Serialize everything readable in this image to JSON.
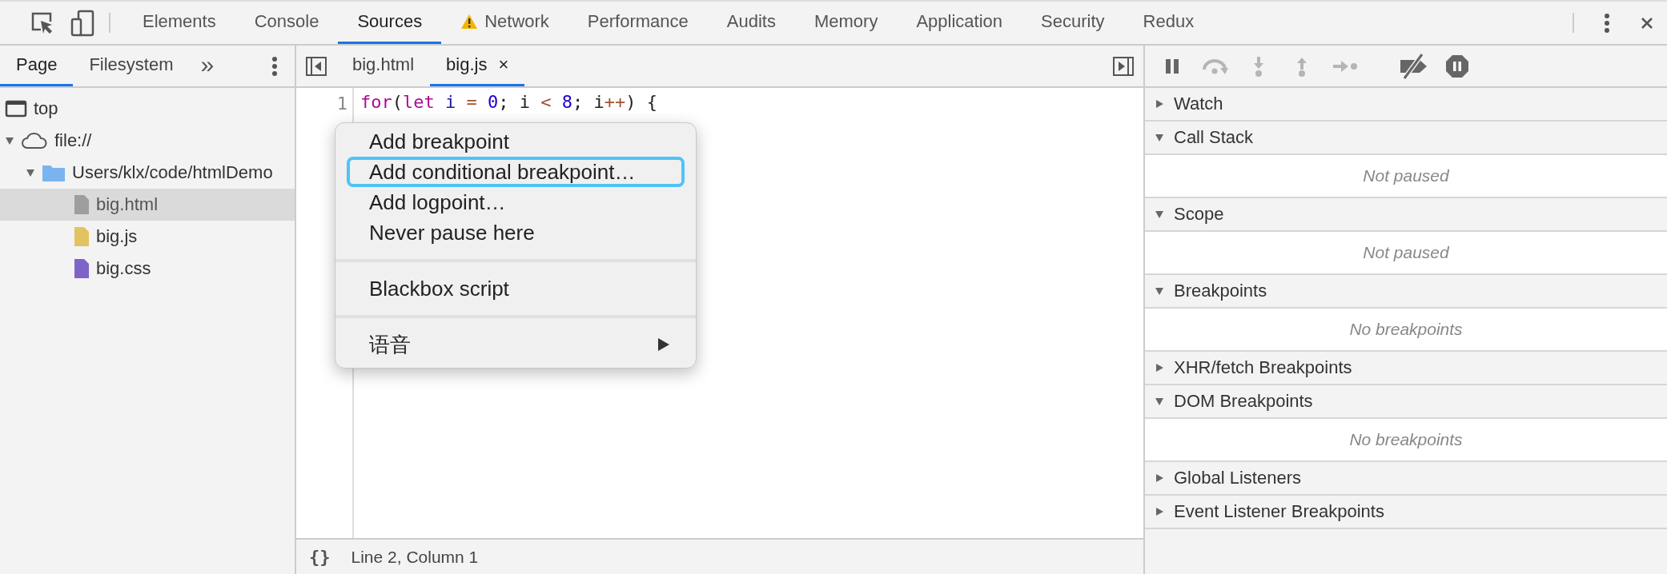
{
  "main_tabs": [
    {
      "label": "Elements",
      "selected": false,
      "warning": false
    },
    {
      "label": "Console",
      "selected": false,
      "warning": false
    },
    {
      "label": "Sources",
      "selected": true,
      "warning": false
    },
    {
      "label": "Network",
      "selected": false,
      "warning": true
    },
    {
      "label": "Performance",
      "selected": false,
      "warning": false
    },
    {
      "label": "Audits",
      "selected": false,
      "warning": false
    },
    {
      "label": "Memory",
      "selected": false,
      "warning": false
    },
    {
      "label": "Application",
      "selected": false,
      "warning": false
    },
    {
      "label": "Security",
      "selected": false,
      "warning": false
    },
    {
      "label": "Redux",
      "selected": false,
      "warning": false
    }
  ],
  "navigator": {
    "tabs": [
      {
        "label": "Page",
        "selected": true
      },
      {
        "label": "Filesystem",
        "selected": false
      }
    ],
    "more": "»",
    "tree": [
      {
        "label": "top",
        "kind": "frame",
        "selected": false
      },
      {
        "label": "file://",
        "kind": "origin",
        "expanded": true,
        "selected": false,
        "children": [
          {
            "label": "Users/klx/code/htmlDemo",
            "kind": "folder",
            "expanded": true,
            "selected": false,
            "children": [
              {
                "label": "big.html",
                "kind": "file",
                "color": "#9e9e9e",
                "selected": true
              },
              {
                "label": "big.js",
                "kind": "file",
                "color": "#e2c35f",
                "selected": false
              },
              {
                "label": "big.css",
                "kind": "file",
                "color": "#7e63c9",
                "selected": false
              }
            ]
          }
        ]
      }
    ]
  },
  "editor": {
    "tabs": [
      {
        "label": "big.html",
        "selected": false,
        "closable": false
      },
      {
        "label": "big.js",
        "selected": true,
        "closable": true
      }
    ],
    "close_mark": "×",
    "line_numbers": [
      "1"
    ],
    "code_line": [
      {
        "text": "for",
        "kind": "keyword"
      },
      {
        "text": "(",
        "kind": "plain"
      },
      {
        "text": "let",
        "kind": "keyword"
      },
      {
        "text": " i",
        "kind": "variable"
      },
      {
        "text": " = ",
        "kind": "operator"
      },
      {
        "text": "0",
        "kind": "number"
      },
      {
        "text": "; i ",
        "kind": "plain"
      },
      {
        "text": "< ",
        "kind": "operator"
      },
      {
        "text": "8",
        "kind": "number"
      },
      {
        "text": "; i",
        "kind": "plain"
      },
      {
        "text": "++",
        "kind": "operator"
      },
      {
        "text": ") {",
        "kind": "plain"
      }
    ],
    "pretty_print": "{}",
    "context_menu": [
      {
        "kind": "item",
        "label": "Add breakpoint",
        "selected": false
      },
      {
        "kind": "item",
        "label": "Add conditional breakpoint…",
        "selected": true
      },
      {
        "kind": "item",
        "label": "Add logpoint…",
        "selected": false
      },
      {
        "kind": "item",
        "label": "Never pause here",
        "selected": false
      },
      {
        "kind": "separator"
      },
      {
        "kind": "item",
        "label": "Blackbox script",
        "selected": false
      },
      {
        "kind": "separator"
      },
      {
        "kind": "submenu",
        "label": "语音",
        "selected": false
      }
    ],
    "status": "Line 2, Column 1"
  },
  "debugger": {
    "controls": [
      {
        "kind": "pause",
        "disabled": false
      },
      {
        "kind": "step-over",
        "disabled": true
      },
      {
        "kind": "step-into",
        "disabled": true
      },
      {
        "kind": "step-out",
        "disabled": true
      },
      {
        "kind": "step",
        "disabled": true
      },
      {
        "kind": "deactivate",
        "disabled": false
      },
      {
        "kind": "pause-exceptions",
        "disabled": false
      }
    ],
    "sections": [
      {
        "title": "Watch",
        "expanded": false
      },
      {
        "title": "Call Stack",
        "expanded": true,
        "message": "Not paused"
      },
      {
        "title": "Scope",
        "expanded": true,
        "message": "Not paused"
      },
      {
        "title": "Breakpoints",
        "expanded": true,
        "message": "No breakpoints"
      },
      {
        "title": "XHR/fetch Breakpoints",
        "expanded": false
      },
      {
        "title": "DOM Breakpoints",
        "expanded": true,
        "message": "No breakpoints"
      },
      {
        "title": "Global Listeners",
        "expanded": false
      },
      {
        "title": "Event Listener Breakpoints",
        "expanded": false
      }
    ]
  }
}
